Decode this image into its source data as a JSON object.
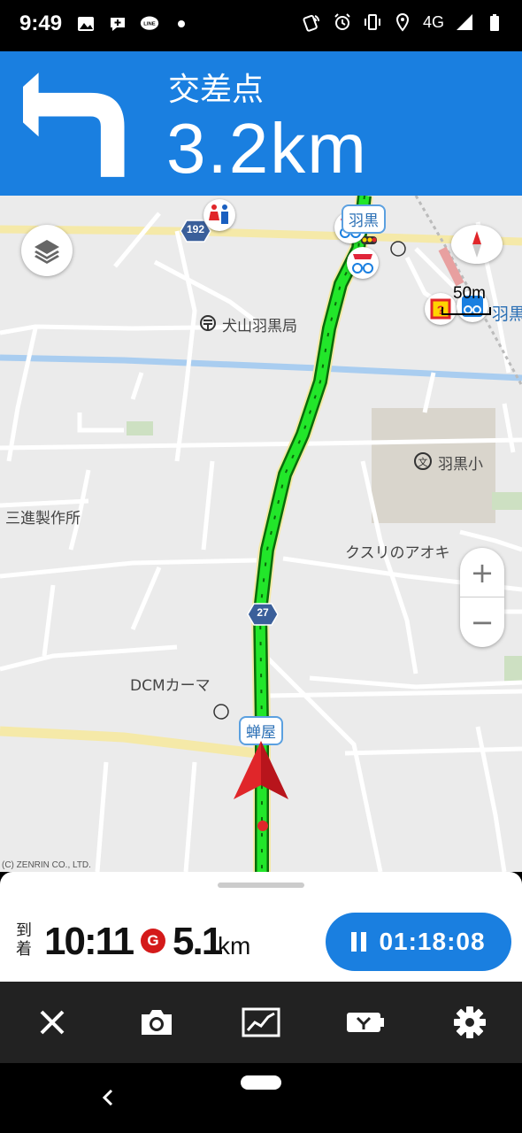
{
  "status_bar": {
    "time": "9:49",
    "network": "4G",
    "icons": [
      "image-icon",
      "chat-plus-icon",
      "line-app-icon",
      "dot-icon",
      "nfc-icon",
      "alarm-icon",
      "vibrate-icon",
      "location-icon",
      "signal-icon",
      "battery-icon"
    ]
  },
  "turn": {
    "direction": "turn-left",
    "name": "交差点",
    "distance": "3.2km"
  },
  "map": {
    "labels": {
      "post_office": "犬山羽黒局",
      "school": "羽黒小",
      "company": "三進製作所",
      "drugstore": "クスリのアオキ",
      "dcm": "DCMカーマ",
      "hakuro_east": "羽黒"
    },
    "place_tags": {
      "top": "羽黒",
      "bottom": "蝉屋"
    },
    "road_shields": [
      "192",
      "27"
    ],
    "scale": "50m",
    "copyright": "(C) ZENRIN CO., LTD.",
    "zoom_in": "+",
    "zoom_out": "−",
    "colors": {
      "route": "#22e62a",
      "road_major": "#f5e9a8",
      "road_minor": "#ffffff",
      "river": "#a9cdf0",
      "shield": "#3a5f9a",
      "heading": "#e0262a"
    }
  },
  "trip": {
    "arrival_label": "到着",
    "arrival_time": "10:11",
    "goal_icon_label": "G",
    "goal_distance": "5.1",
    "goal_unit": "km",
    "elapsed": "01:18:08"
  },
  "toolbar": {
    "buttons": [
      "close-icon",
      "camera-icon",
      "chart-icon",
      "battery-bike-icon",
      "gear-icon"
    ]
  }
}
